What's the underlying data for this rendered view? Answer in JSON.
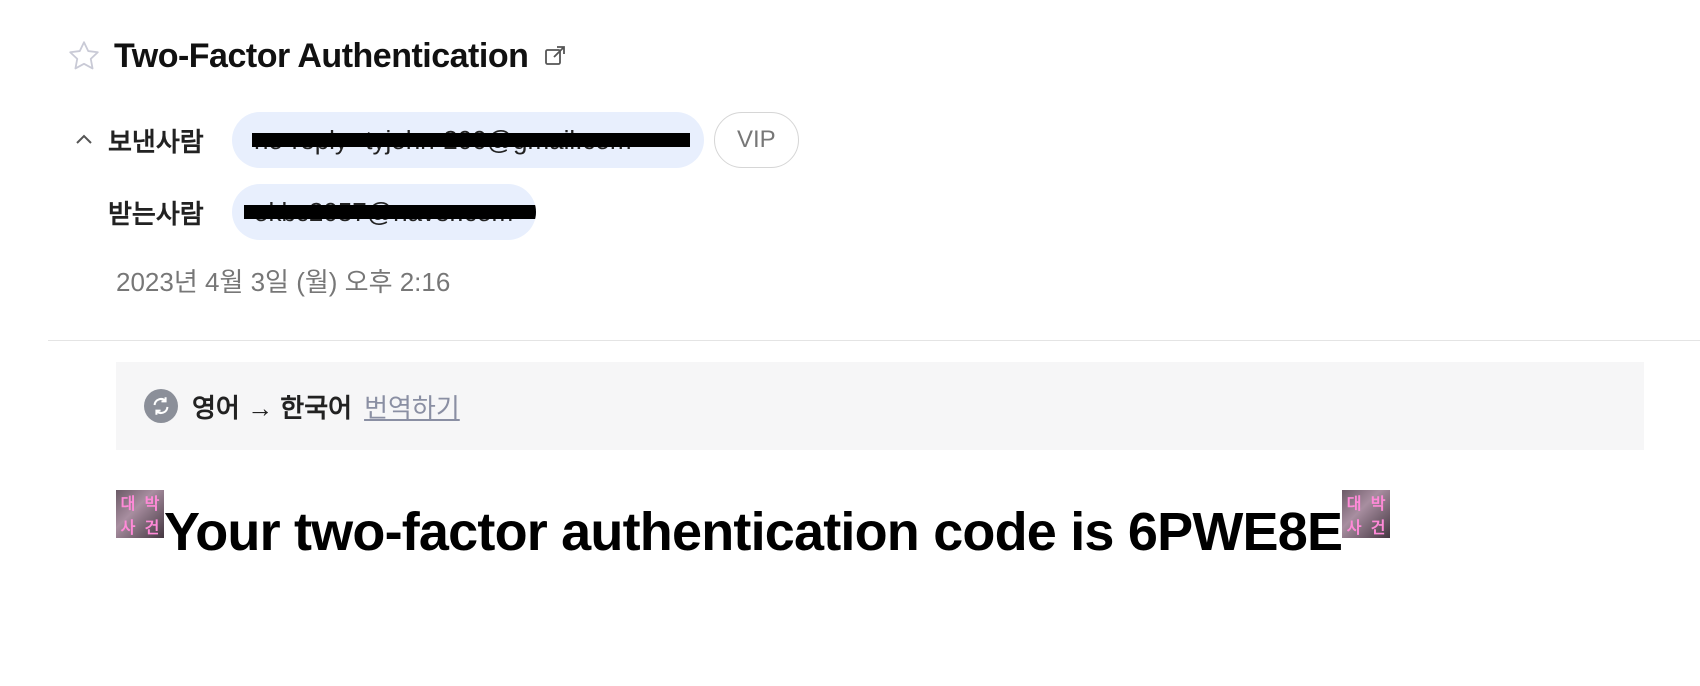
{
  "header": {
    "subject": "Two-Factor Authentication"
  },
  "sender": {
    "label": "보낸사람",
    "address": "no-reply--tyjohn-200@gmail.com",
    "badge": "VIP"
  },
  "receiver": {
    "label": "받는사람",
    "address": "okbc2057@naver.com"
  },
  "date": "2023년 4월 3일 (월) 오후 2:16",
  "translate": {
    "languages": "영어 → 한국어",
    "action": "번역하기"
  },
  "body": {
    "message": "Your two-factor authentication code is 6PWE8E",
    "thumb_chars": [
      "대",
      "박",
      "사",
      "건"
    ]
  },
  "icons": {
    "star": "star-icon",
    "popout": "external-link-icon",
    "collapse": "chevron-up-icon",
    "translate": "translate-icon"
  },
  "colors": {
    "chip": "#e8effd",
    "link": "#8a8fa3",
    "muted": "#777777"
  }
}
